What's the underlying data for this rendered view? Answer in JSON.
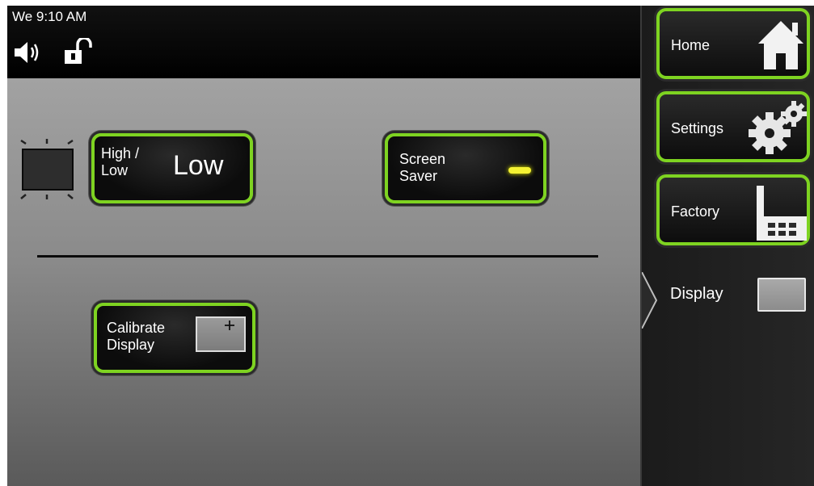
{
  "status": {
    "clock": "We 9:10 AM",
    "speaker_icon": "speaker-on-icon",
    "lock_icon": "unlocked-padlock-icon"
  },
  "main": {
    "brightness_indicator_icon": "brightness-icon",
    "high_low": {
      "label_line1": "High /",
      "label_line2": "Low",
      "value": "Low"
    },
    "screen_saver": {
      "label_line1": "Screen",
      "label_line2": "Saver",
      "indicator_color": "#f5f233"
    },
    "calibrate": {
      "label_line1": "Calibrate",
      "label_line2": "Display",
      "icon": "calibrate-crosshair-icon"
    }
  },
  "sidebar": {
    "home": {
      "label": "Home",
      "icon": "house-icon"
    },
    "settings": {
      "label": "Settings",
      "icon": "gears-icon"
    },
    "factory": {
      "label": "Factory",
      "icon": "factory-icon"
    },
    "current": {
      "label": "Display",
      "icon": "display-square-icon"
    }
  },
  "colors": {
    "accent": "#7ed321",
    "button_bg": "#0c0c0c",
    "panel_top": "#a2a2a2",
    "panel_bottom": "#5a5a5a",
    "sidebar_bg": "#1f1f1f"
  }
}
